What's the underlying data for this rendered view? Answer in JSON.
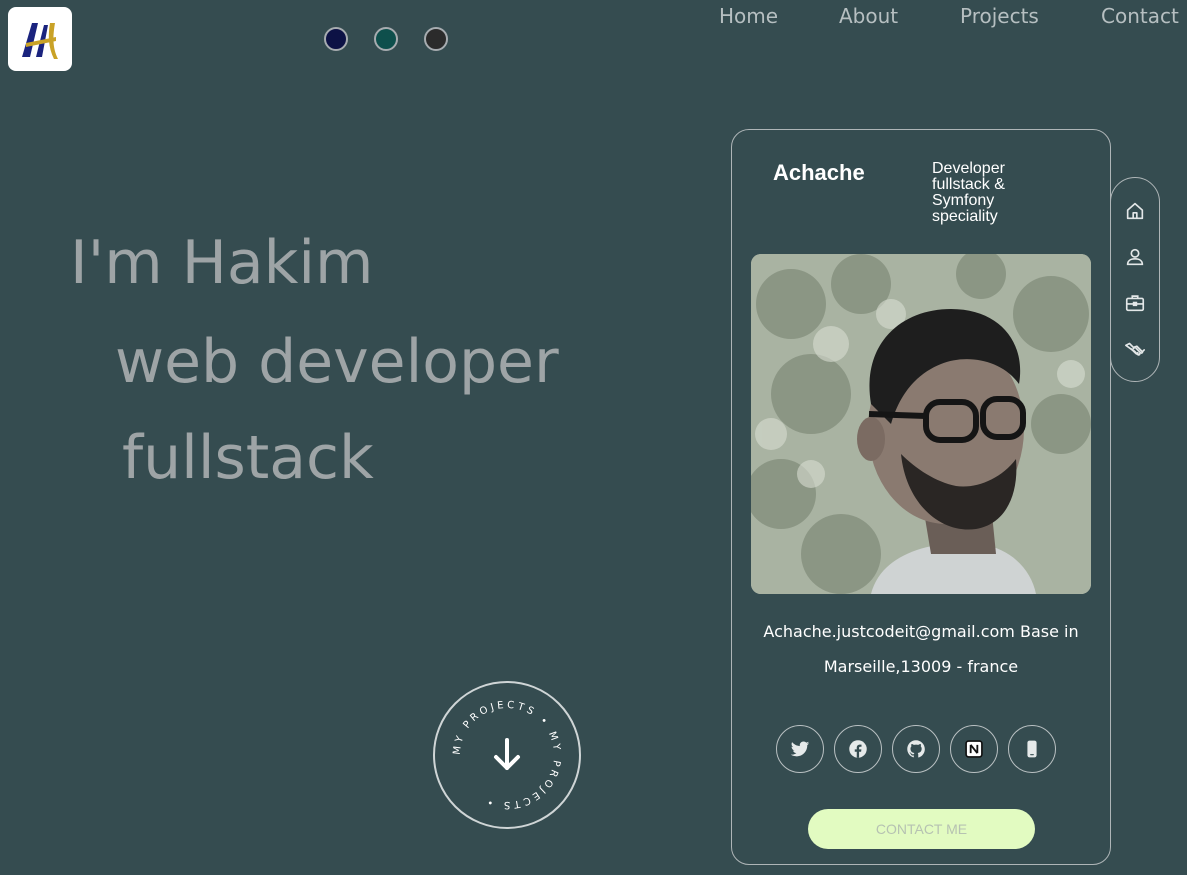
{
  "logo": {
    "letters": "AH",
    "colors": [
      "#1a237e",
      "#c9a227"
    ]
  },
  "theme_switcher": [
    {
      "name": "navy",
      "color": "#0d1245"
    },
    {
      "name": "teal",
      "color": "#0e4f4c"
    },
    {
      "name": "dark",
      "color": "#2b2b2b"
    }
  ],
  "nav": {
    "home": "Home",
    "about": "About",
    "projects": "Projects",
    "contact": "Contact"
  },
  "hero": {
    "line1": "I'm Hakim",
    "line2": "web developer",
    "line3": "fullstack"
  },
  "scroll_badge": {
    "text": "MY PROJECTS • MY PROJECTS •",
    "icon": "arrow-down-icon"
  },
  "profile_card": {
    "name": "Achache",
    "role": "Developer fullstack & Symfony speciality",
    "info_line1": "Achache.justcodeit@gmail.com Base in",
    "info_line2": "Marseille,13009 - france",
    "socials": [
      "twitter-icon",
      "facebook-icon",
      "github-icon",
      "notion-icon",
      "phone-icon"
    ],
    "contact_label": "CONTACT ME"
  },
  "side_nav": {
    "icons": [
      "home-icon",
      "user-icon",
      "briefcase-icon",
      "handshake-icon"
    ]
  }
}
